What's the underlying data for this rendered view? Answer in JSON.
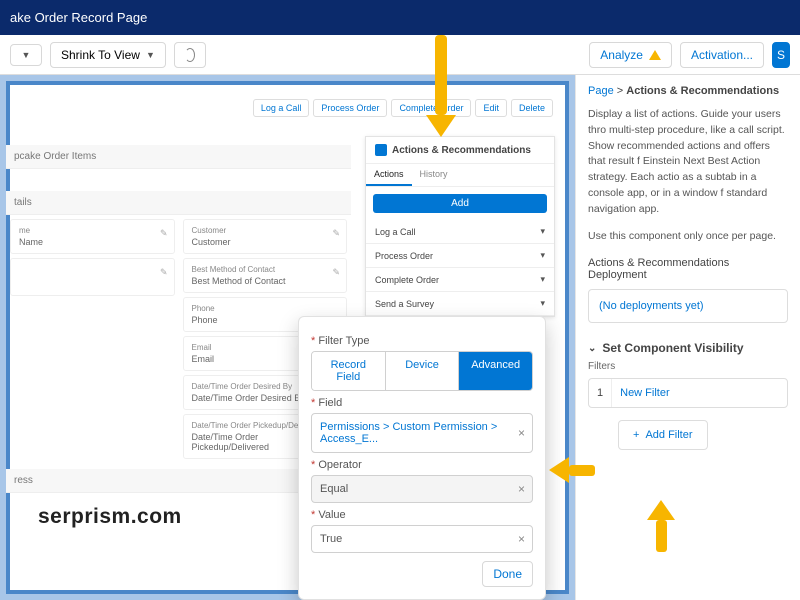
{
  "topbar": {
    "title": "ake Order Record Page"
  },
  "toolbar": {
    "shrink": "Shrink To View",
    "analyze": "Analyze",
    "activation": "Activation..."
  },
  "preview": {
    "actions": {
      "log": "Log a Call",
      "process": "Process Order",
      "complete": "Complete Order",
      "edit": "Edit",
      "delete": "Delete"
    },
    "items_title": "pcake Order Items",
    "details_title": "tails",
    "address_title": "ress",
    "ar": {
      "title": "Actions & Recommendations",
      "tab_actions": "Actions",
      "tab_history": "History",
      "add": "Add",
      "rows": {
        "log": "Log a Call",
        "process": "Process Order",
        "complete": "Complete Order",
        "survey": "Send a Survey"
      }
    },
    "fields": {
      "name": {
        "l": "me",
        "v": "Name"
      },
      "customer": {
        "l": "Customer",
        "v": "Customer"
      },
      "contact": {
        "l": "Best Method of Contact",
        "v": "Best Method of Contact"
      },
      "phone": {
        "l": "Phone",
        "v": "Phone"
      },
      "email": {
        "l": "Email",
        "v": "Email"
      },
      "desired": {
        "l": "Date/Time Order Desired By",
        "v": "Date/Time Order Desired By"
      },
      "pickup": {
        "l": "Date/Time Order Pickedup/Delivered",
        "v": "Date/Time Order Pickedup/Delivered"
      }
    }
  },
  "side": {
    "crumb_page": "Page",
    "crumb_sep": ">",
    "crumb_current": "Actions & Recommendations",
    "desc1": "Display a list of actions. Guide your users thro multi-step procedure, like a call script. Show recommended actions and offers that result f Einstein Next Best Action strategy. Each actio as a subtab in a console app, or in a window f standard navigation app.",
    "desc2": "Use this component only once per page.",
    "deploy_title": "Actions & Recommendations Deployment",
    "deploy_empty": "(No deployments yet)",
    "vis_title": "Set Component Visibility",
    "filters_label": "Filters",
    "filter1_num": "1",
    "filter1_name": "New Filter",
    "add_filter": "Add Filter"
  },
  "modal": {
    "filter_type": "Filter Type",
    "seg_record": "Record Field",
    "seg_device": "Device",
    "seg_advanced": "Advanced",
    "field_label": "Field",
    "field_value": "Permissions > Custom Permission > Access_E...",
    "operator_label": "Operator",
    "operator_value": "Equal",
    "value_label": "Value",
    "value_value": "True",
    "done": "Done"
  },
  "watermark": "serprism.com"
}
